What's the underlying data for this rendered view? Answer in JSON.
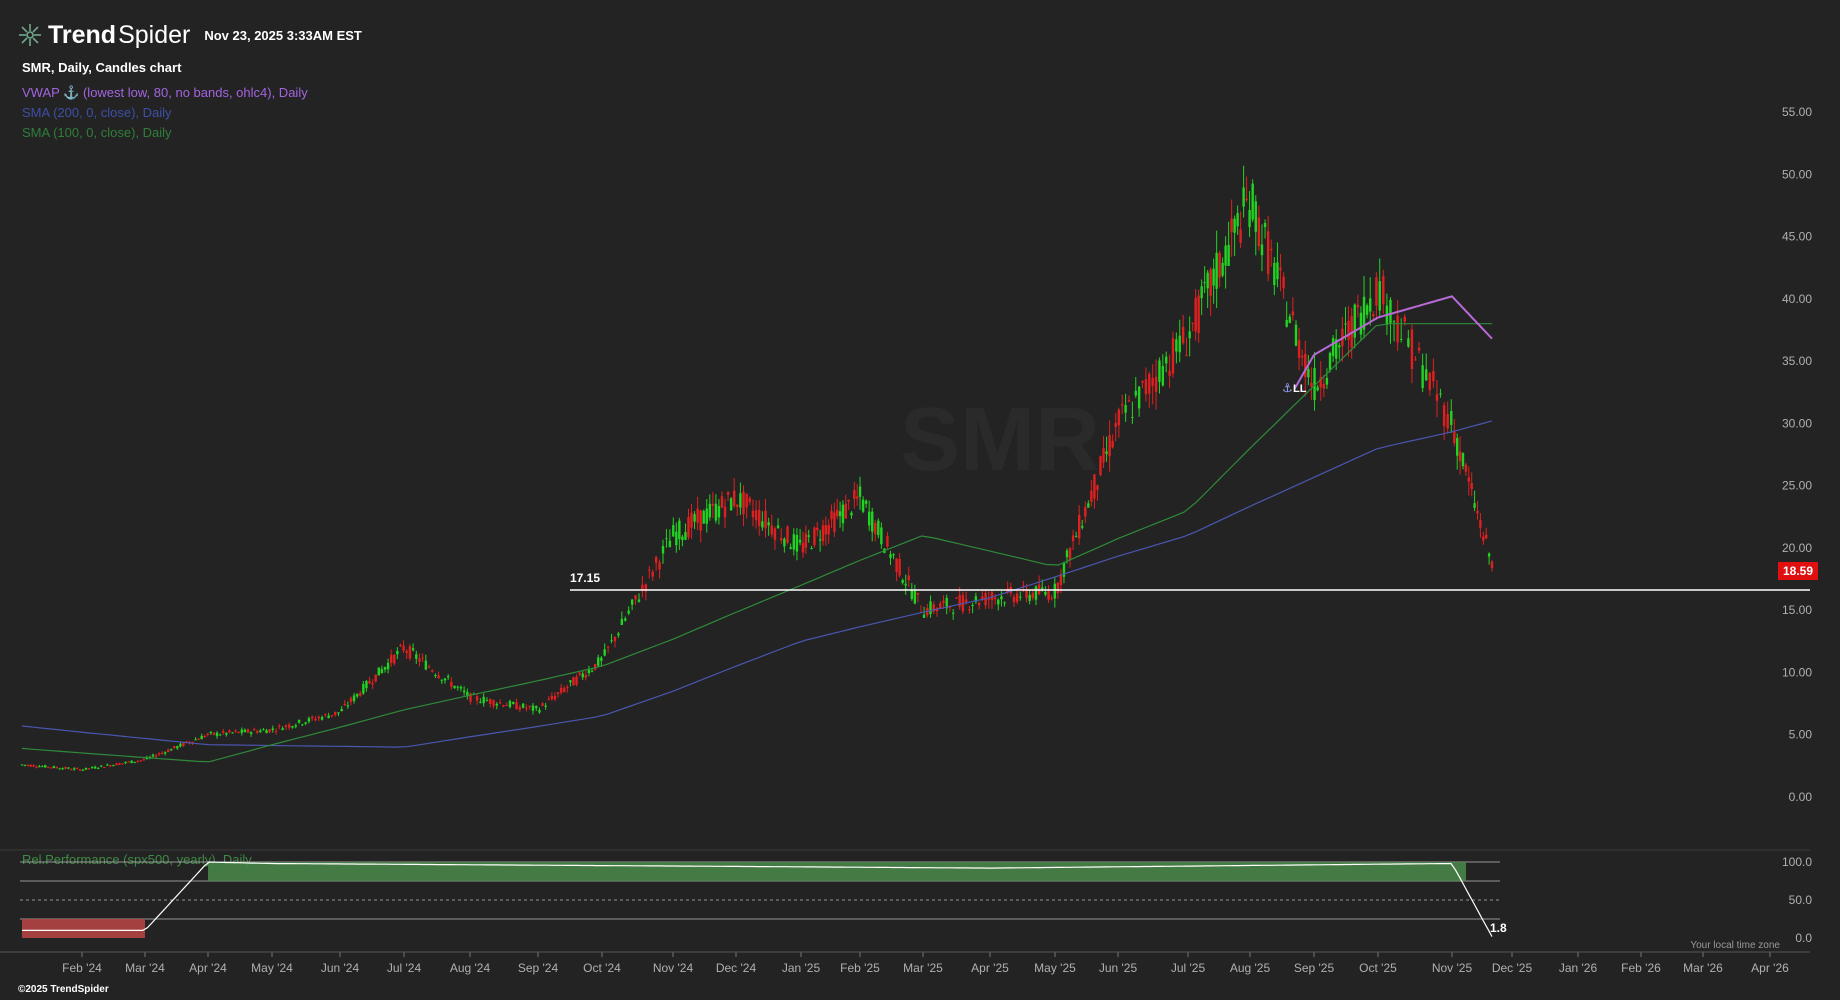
{
  "header": {
    "logo_bold": "Trend",
    "logo_light": "Spider",
    "datetime": "Nov 23, 2025 3:33AM EST"
  },
  "chart_title": "SMR, Daily, Candles chart",
  "indicators": {
    "vwap": "VWAP ⚓ (lowest low, 80, no bands, ohlc4), Daily",
    "sma200": "SMA (200, 0, close), Daily",
    "sma100": "SMA (100, 0, close), Daily"
  },
  "watermark": "SMR",
  "copyright": "©2025 TrendSpider",
  "local_time": "Your local time zone",
  "colors": {
    "up": "#22d422",
    "down": "#e02020",
    "sma200": "#4a56b0",
    "sma100": "#2f8a3a",
    "vwap": "#b86ad8",
    "rel_fill": "#4a8a4a",
    "rel_neg": "#b34444",
    "price_tag": "#e01010"
  },
  "chart_data": [
    {
      "type": "candlestick",
      "title": "SMR, Daily, Candles chart",
      "x_ticks": [
        "Feb '24",
        "Mar '24",
        "Apr '24",
        "May '24",
        "Jun '24",
        "Jul '24",
        "Aug '24",
        "Sep '24",
        "Oct '24",
        "Nov '24",
        "Dec '24",
        "Jan '25",
        "Feb '25",
        "Mar '25",
        "Apr '25",
        "May '25",
        "Jun '25",
        "Jul '25",
        "Aug '25",
        "Sep '25",
        "Oct '25",
        "Nov '25",
        "Dec '25",
        "Jan '26",
        "Feb '26",
        "Mar '26",
        "Apr '26"
      ],
      "y_ticks": [
        "0.00",
        "5.00",
        "10.00",
        "15.00",
        "20.00",
        "25.00",
        "30.00",
        "35.00",
        "40.00",
        "45.00",
        "50.00",
        "55.00"
      ],
      "ylim": [
        0,
        55
      ],
      "last_price": "18.59",
      "horizontal_line": {
        "label": "17.15",
        "value": 17.15
      },
      "vwap_anchor_label": "LL",
      "series": [
        {
          "name": "SMR",
          "x": [
            "Jan '24",
            "Feb '24",
            "Mar '24",
            "Apr '24",
            "May '24",
            "Jun '24",
            "Jul '24",
            "Aug '24",
            "Sep '24",
            "Oct '24",
            "Nov '24",
            "Dec '24",
            "Jan '25",
            "Feb '25",
            "Mar '25",
            "Apr '25",
            "May '25",
            "Jun '25",
            "Jul '25",
            "Aug '25",
            "Sep '25",
            "Oct '25",
            "Nov '25",
            "Nov 21 '25"
          ],
          "close": [
            2.6,
            2.2,
            3.0,
            5.0,
            5.4,
            6.8,
            12.0,
            8.0,
            7.0,
            11.0,
            21.0,
            24.0,
            20.0,
            24.0,
            15.0,
            16.0,
            16.5,
            30.0,
            37.0,
            48.0,
            33.0,
            41.0,
            30.0,
            18.59
          ]
        },
        {
          "name": "SMA (200, 0, close), Daily",
          "x": [
            "Jan '24",
            "Apr '24",
            "Jul '24",
            "Oct '24",
            "Jan '25",
            "Apr '25",
            "Jul '25",
            "Oct '25",
            "Nov 21 '25"
          ],
          "values": [
            5.7,
            4.2,
            4.0,
            6.5,
            12.5,
            16.0,
            21.0,
            28.0,
            30.2
          ]
        },
        {
          "name": "SMA (100, 0, close), Daily",
          "x": [
            "Jan '24",
            "Apr '24",
            "Jul '24",
            "Oct '24",
            "Jan '25",
            "Mar '25",
            "May '25",
            "Jul '25",
            "Sep '25",
            "Oct '25",
            "Nov 21 '25"
          ],
          "values": [
            3.9,
            2.8,
            7.0,
            10.5,
            17.0,
            21.0,
            18.5,
            23.0,
            33.0,
            38.0,
            38.0
          ]
        },
        {
          "name": "VWAP ⚓ (lowest low, 80, no bands, ohlc4), Daily",
          "x": [
            "Aug 22 '25",
            "Sep '25",
            "Oct '25",
            "Nov '25",
            "Nov 21 '25"
          ],
          "values": [
            32.8,
            35.5,
            38.5,
            40.2,
            36.8
          ]
        }
      ]
    },
    {
      "type": "area",
      "title": "Rel.Performance (spx500, yearly), Daily",
      "y_ticks": [
        "100.0",
        "50.0",
        "0.0"
      ],
      "ylim": [
        0,
        100
      ],
      "last_value": "1.8",
      "series": [
        {
          "name": "Rel.Performance (spx500, yearly), Daily",
          "x": [
            "Jan '24",
            "Mar '24",
            "Apr '24",
            "May '24",
            "Apr '25",
            "Nov '25",
            "Nov 21 '25"
          ],
          "values": [
            10,
            10,
            100,
            98,
            92,
            98,
            1.8
          ]
        }
      ]
    }
  ]
}
